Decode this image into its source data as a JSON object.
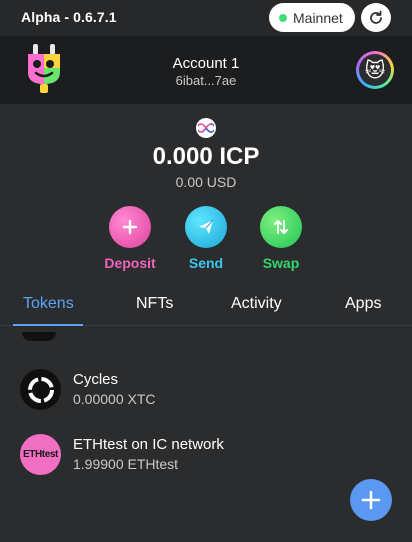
{
  "topbar": {
    "version": "Alpha - 0.6.7.1",
    "network_label": "Mainnet",
    "refresh_icon": "refresh-icon",
    "network_status_color": "#3fdd78"
  },
  "account": {
    "name": "Account 1",
    "address": "6ibat...7ae",
    "logo_icon": "plug-logo-icon",
    "avatar_icon": "cat-avatar-icon",
    "avatar_emoji": "😻"
  },
  "balance": {
    "icp": "0.000 ICP",
    "usd": "0.00 USD",
    "logo_icon": "dfinity-icon"
  },
  "actions": [
    {
      "label": "Deposit",
      "icon": "plus-icon",
      "color": "#f063bd"
    },
    {
      "label": "Send",
      "icon": "paper-plane-icon",
      "color": "#3bc7ee"
    },
    {
      "label": "Swap",
      "icon": "swap-arrows-icon",
      "color": "#33d46a"
    }
  ],
  "tabs": [
    {
      "label": "Tokens",
      "active": true
    },
    {
      "label": "NFTs",
      "active": false
    },
    {
      "label": "Activity",
      "active": false
    },
    {
      "label": "Apps",
      "active": false
    }
  ],
  "tokens": [
    {
      "name": "Cycles",
      "amount": "0.00000 XTC",
      "icon": "cycles-icon"
    },
    {
      "name": "ETHtest on IC network",
      "amount": "1.99900 ETHtest",
      "icon_text": "ETHtest"
    }
  ],
  "fab": {
    "icon": "plus-icon"
  },
  "colors": {
    "accent": "#5aa4f8",
    "background": "#2b2c2e"
  }
}
